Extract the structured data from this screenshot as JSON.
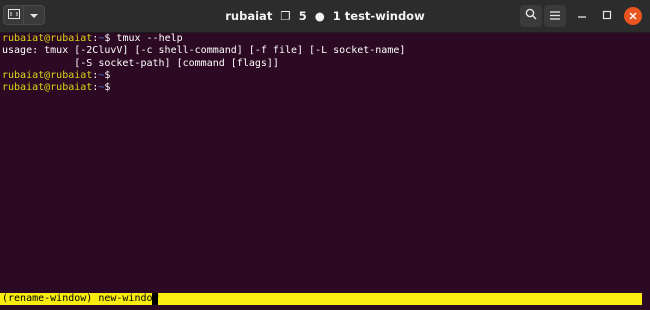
{
  "window": {
    "title_user": "rubaiat",
    "title_sessions": "5",
    "title_window_name": "1 test-window",
    "icons": {
      "new_tab": "terminal-tab-icon",
      "dropdown": "chevron-down-icon",
      "search": "search-icon",
      "menu": "hamburger-menu-icon",
      "minimize": "minimize-icon",
      "maximize": "maximize-icon",
      "close": "close-icon"
    },
    "accent_close": "#e95420"
  },
  "terminal": {
    "background": "#2c0a23",
    "prompt_user_color": "#d8d816",
    "prompt_path_color": "#3d7fd8",
    "lines": [
      {
        "user": "rubaiat@rubaiat",
        "sep": ":",
        "path": "~",
        "dollar": "$ ",
        "command": "tmux --help"
      },
      {
        "text": "usage: tmux [-2CluvV] [-c shell-command] [-f file] [-L socket-name]"
      },
      {
        "text": "            [-S socket-path] [command [flags]]"
      },
      {
        "user": "rubaiat@rubaiat",
        "sep": ":",
        "path": "~",
        "dollar": "$",
        "command": ""
      },
      {
        "user": "rubaiat@rubaiat",
        "sep": ":",
        "path": "~",
        "dollar": "$",
        "command": ""
      }
    ]
  },
  "statusbar": {
    "text": "(rename-window) new-window",
    "background": "#f9ec10"
  }
}
